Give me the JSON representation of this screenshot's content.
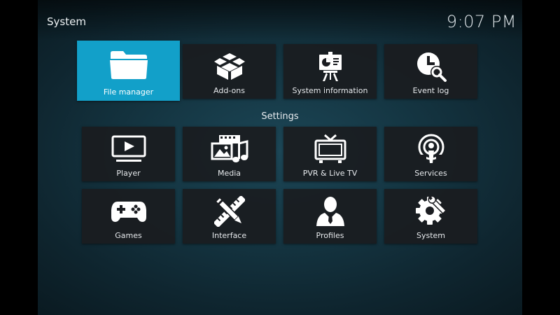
{
  "header": {
    "title": "System",
    "clock": "9:07 PM"
  },
  "top_row": [
    {
      "label": "File manager",
      "icon": "folder-icon",
      "focused": true
    },
    {
      "label": "Add-ons",
      "icon": "addon-box-icon"
    },
    {
      "label": "System information",
      "icon": "presentation-chart-icon"
    },
    {
      "label": "Event log",
      "icon": "clock-search-icon"
    }
  ],
  "settings": {
    "label": "Settings",
    "items": [
      {
        "label": "Player",
        "icon": "play-monitor-icon"
      },
      {
        "label": "Media",
        "icon": "media-film-music-icon"
      },
      {
        "label": "PVR & Live TV",
        "icon": "tv-antenna-icon"
      },
      {
        "label": "Services",
        "icon": "podcast-broadcast-icon"
      },
      {
        "label": "Games",
        "icon": "gamepad-icon"
      },
      {
        "label": "Interface",
        "icon": "pencil-ruler-icon"
      },
      {
        "label": "Profiles",
        "icon": "person-icon"
      },
      {
        "label": "System",
        "icon": "gear-wrench-icon"
      }
    ]
  },
  "colors": {
    "accent": "#12a0c9",
    "tile_bg": "#1a1c20",
    "background": "#153744"
  }
}
